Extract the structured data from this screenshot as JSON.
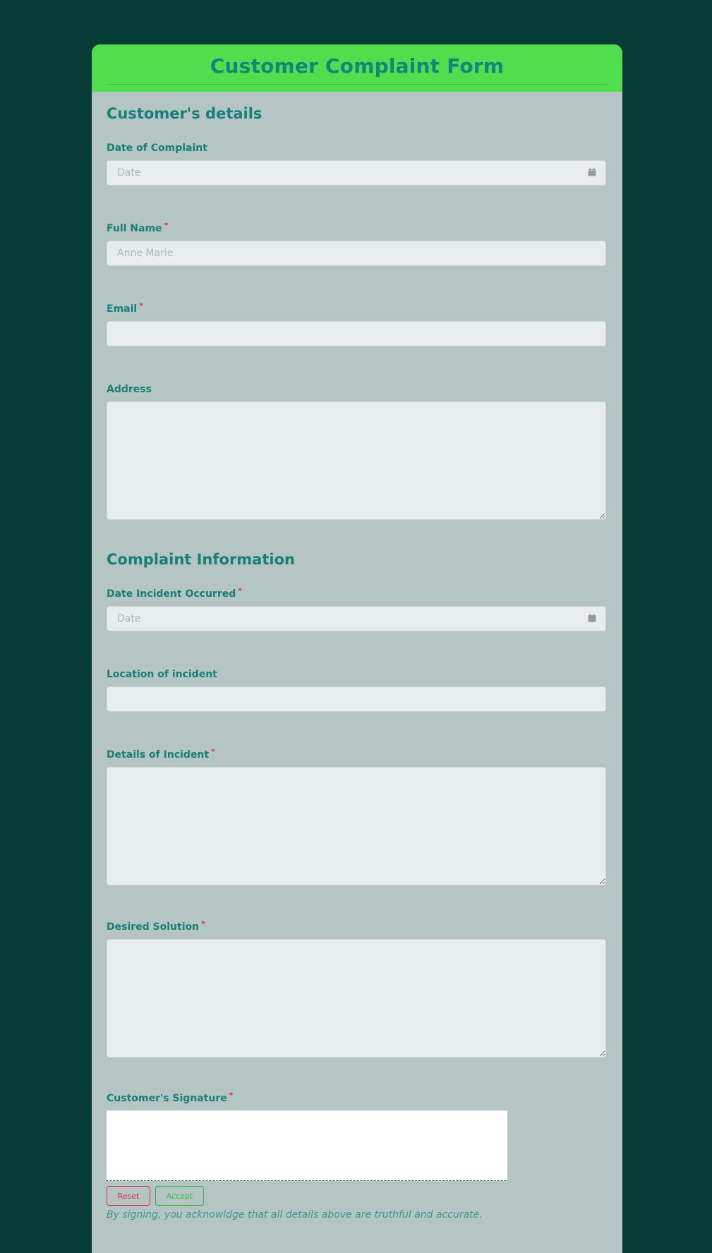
{
  "form": {
    "title": "Customer Complaint Form",
    "sections": {
      "customer": "Customer's details",
      "complaint": "Complaint Information"
    },
    "fields": {
      "date_of_complaint": {
        "label": "Date of Complaint",
        "placeholder": "Date",
        "value": "",
        "required": false,
        "icon": "calendar-icon"
      },
      "full_name": {
        "label": "Full Name",
        "placeholder": "Anne Marie",
        "value": "",
        "required": true
      },
      "email": {
        "label": "Email",
        "placeholder": "",
        "value": "",
        "required": true
      },
      "address": {
        "label": "Address",
        "placeholder": "",
        "value": "",
        "required": false
      },
      "date_incident": {
        "label": "Date Incident Occurred",
        "placeholder": "Date",
        "value": "",
        "required": true,
        "icon": "calendar-icon"
      },
      "location": {
        "label": "Location of incident",
        "placeholder": "",
        "value": "",
        "required": false
      },
      "details": {
        "label": "Details of Incident",
        "placeholder": "",
        "value": "",
        "required": true
      },
      "solution": {
        "label": "Desired Solution",
        "placeholder": "",
        "value": "",
        "required": true
      },
      "signature": {
        "label": "Customer's Signature",
        "required": true
      }
    },
    "required_marker": "*",
    "buttons": {
      "reset": "Reset",
      "accept": "Accept"
    },
    "signature_note": "By signing, you acknowldge that all details above are truthful and accurate."
  },
  "colors": {
    "page_bg": "#063a36",
    "header_bg": "#50de4f",
    "form_bg": "#b4c5c3",
    "accent_text": "#157f78",
    "required": "#e0394a",
    "reset": "#d93040",
    "accept": "#2fb84c"
  }
}
